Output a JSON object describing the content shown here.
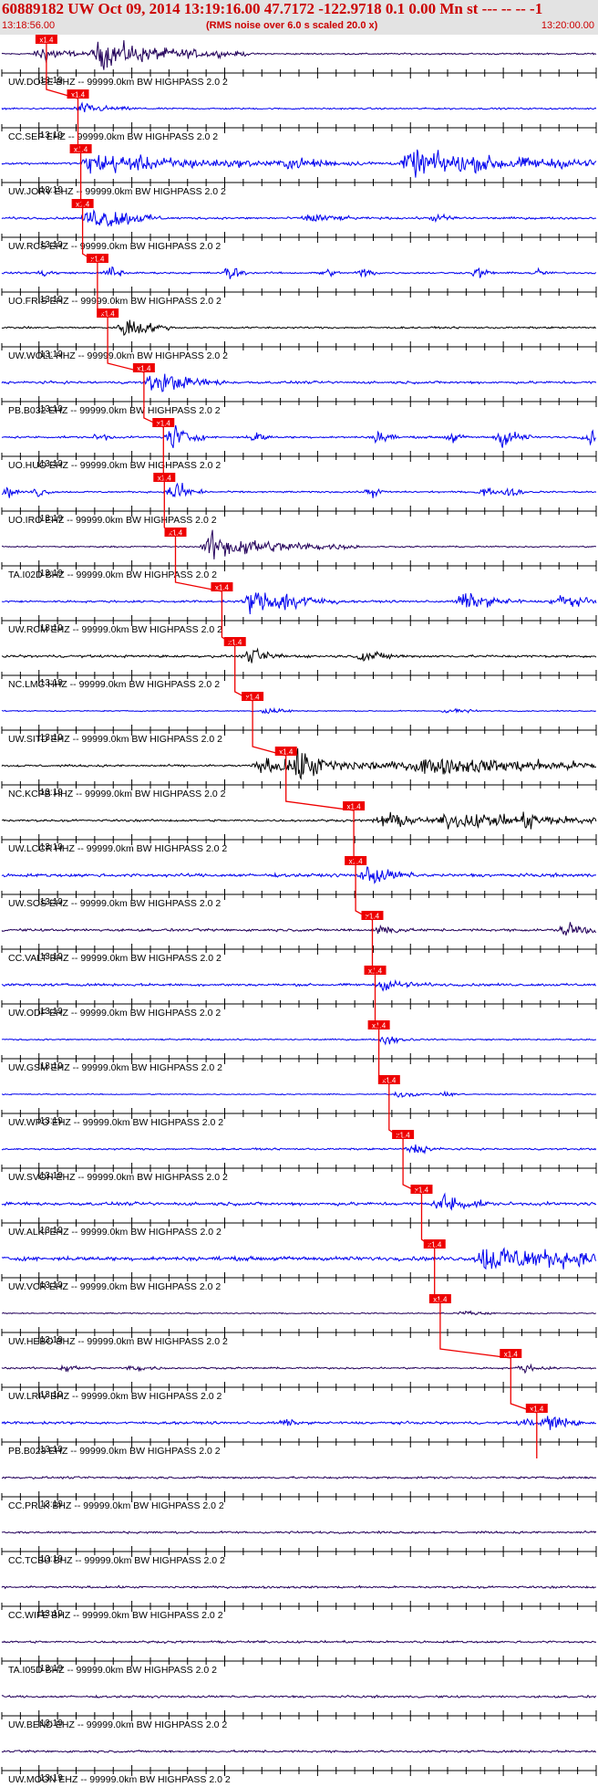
{
  "header": {
    "title": "60889182 UW Oct 09, 2014 13:19:16.00   47.7172 -122.9718  0.1 0.00 Mn st --- -- --   -1",
    "start_time": "13:18:56.00",
    "rms_note": "(RMS noise over 6.0 s scaled 20.0 x)",
    "end_time": "13:20:00.00"
  },
  "colors": {
    "blue_trace": "#0000ee",
    "black_trace": "#000000",
    "navy_trace": "#23005a",
    "pick": "#ee0000",
    "header_text": "#cc0000",
    "header_bg": "#e3e3e3"
  },
  "chart_data": {
    "type": "line",
    "x_unit": "seconds after 13:18:56.00",
    "x_range": [
      0,
      64
    ],
    "time_marker_label": "13:19",
    "time_marker_x": 4,
    "pick_label": "x1.4",
    "stations": [
      {
        "label": "UW.DOSE BHZ -- 99999.0km BW  HIGHPASS  2.0  2",
        "color": "navy",
        "pick": 4.8,
        "events": [
          [
            10.6,
            10,
            4.0
          ],
          [
            4.5,
            3,
            2.6
          ]
        ],
        "noise": 0.22
      },
      {
        "label": "CC.SEP EHZ -- 99999.0km BW  HIGHPASS  2.0  2",
        "color": "blue",
        "pick": 8.2,
        "events": [
          [
            8.6,
            4,
            1.4
          ]
        ],
        "noise": 0.22
      },
      {
        "label": "UW.JORV EHZ -- 99999.0km BW  HIGHPASS  2.0  2",
        "color": "blue",
        "pick": 8.5,
        "events": [
          [
            9.5,
            16,
            2.9
          ],
          [
            44,
            18,
            3.6
          ],
          [
            31,
            8,
            1.0
          ]
        ],
        "noise": 0.3
      },
      {
        "label": "UW.RCS EHZ -- 99999.0km BW  HIGHPASS  2.0  2",
        "color": "blue",
        "pick": 8.7,
        "events": [
          [
            9.6,
            5,
            2.6
          ],
          [
            33.4,
            3,
            1.5
          ],
          [
            46.9,
            2,
            1.0
          ],
          [
            11.8,
            3,
            1.6
          ]
        ],
        "noise": 0.3
      },
      {
        "label": "UO.FRIS EHZ -- 99999.0km BW  HIGHPASS  2.0  2",
        "color": "blue",
        "pick": 10.3,
        "events": [
          [
            24.8,
            1,
            2.7
          ],
          [
            12.0,
            1,
            2.4
          ],
          [
            39.1,
            1,
            1.6
          ],
          [
            51.5,
            1,
            1.8
          ],
          [
            4.6,
            1,
            1.2
          ],
          [
            57.8,
            1,
            1.1
          ],
          [
            35.0,
            1,
            1.1
          ]
        ],
        "noise": 0.25
      },
      {
        "label": "UW.WOLL HHZ -- 99999.0km BW  HIGHPASS  2.0  2",
        "color": "black",
        "pick": 11.4,
        "events": [
          [
            13.5,
            3,
            3.4
          ]
        ],
        "noise": 0.25
      },
      {
        "label": "PB.B032 EHZ -- 99999.0km BW  HIGHPASS  2.0  2",
        "color": "blue",
        "pick": 15.3,
        "events": [
          [
            16.5,
            5,
            3.2
          ]
        ],
        "noise": 0.35
      },
      {
        "label": "UO.HUO EHZ -- 99999.0km BW  HIGHPASS  2.0  2",
        "color": "blue",
        "pick": 17.4,
        "events": [
          [
            18.6,
            2,
            4.0
          ],
          [
            41.0,
            1,
            3.0
          ],
          [
            54.0,
            2,
            3.0
          ],
          [
            63.4,
            1,
            2.2
          ],
          [
            27.5,
            1,
            1.7
          ],
          [
            48.6,
            1,
            1.5
          ],
          [
            10.8,
            1,
            1.3
          ]
        ],
        "noise": 0.28
      },
      {
        "label": "UO.IRO EHZ -- 99999.0km BW  HIGHPASS  2.0  2",
        "color": "blue",
        "pick": 17.5,
        "events": [
          [
            18.8,
            2,
            3.2
          ],
          [
            55.0,
            1,
            2.4
          ],
          [
            52.0,
            1,
            1.6
          ],
          [
            0.8,
            1,
            1.5
          ],
          [
            40.0,
            1,
            1.4
          ],
          [
            4.0,
            1,
            1.5
          ]
        ],
        "noise": 0.24
      },
      {
        "label": "TA.I02D BHZ -- 99999.0km BW  HIGHPASS  2.0  2",
        "color": "navy",
        "pick": 18.7,
        "events": [
          [
            22.5,
            10,
            3.8
          ]
        ],
        "noise": 0.2
      },
      {
        "label": "UW.RCM EHZ -- 99999.0km BW  HIGHPASS  2.0  2",
        "color": "blue",
        "pick": 23.7,
        "events": [
          [
            27.0,
            6,
            3.6
          ],
          [
            49.8,
            4,
            2.6
          ],
          [
            60.0,
            3,
            2.2
          ],
          [
            31.0,
            2,
            1.8
          ]
        ],
        "noise": 0.3
      },
      {
        "label": "NC.LMC HHZ -- 99999.0km BW  HIGHPASS  2.0  2",
        "color": "black",
        "pick": 25.1,
        "events": [
          [
            27.0,
            3,
            1.8
          ],
          [
            39.0,
            3,
            1.6
          ]
        ],
        "noise": 0.35
      },
      {
        "label": "UW.SITD EHZ -- 99999.0km BW  HIGHPASS  2.0  2",
        "color": "blue",
        "pick": 27.0,
        "events": [
          [
            28.8,
            2,
            1.3
          ],
          [
            48.4,
            2,
            1.0
          ]
        ],
        "noise": 0.15
      },
      {
        "label": "NC.KCPB HHZ -- 99999.0km BW  HIGHPASS  2.0  2",
        "color": "black",
        "pick": 30.6,
        "events": [
          [
            31.8,
            3,
            3.8
          ],
          [
            28.0,
            25,
            1.9
          ],
          [
            45.0,
            28,
            1.6
          ]
        ],
        "noise": 0.3
      },
      {
        "label": "UW.LCCR HHZ -- 99999.0km BW  HIGHPASS  2.0  2",
        "color": "black",
        "pick": 37.9,
        "events": [
          [
            41.0,
            4,
            2.6
          ],
          [
            48.0,
            22,
            2.0
          ],
          [
            57.0,
            1,
            1.8
          ]
        ],
        "noise": 0.3
      },
      {
        "label": "UW.SOS EHZ -- 99999.0km BW  HIGHPASS  2.0  2",
        "color": "blue",
        "pick": 38.1,
        "events": [
          [
            39.6,
            3,
            2.8
          ]
        ],
        "noise": 0.45
      },
      {
        "label": "CC.VALT BHZ -- 99999.0km BW  HIGHPASS  2.0  2",
        "color": "navy",
        "pick": 39.9,
        "events": [
          [
            41.0,
            2,
            1.6
          ],
          [
            61.0,
            3,
            2.4
          ]
        ],
        "noise": 0.35
      },
      {
        "label": "UW.ODF EHZ -- 99999.0km BW  HIGHPASS  2.0  2",
        "color": "blue",
        "pick": 40.2,
        "events": [
          [
            41.4,
            3,
            1.5
          ]
        ],
        "noise": 0.35
      },
      {
        "label": "UW.GSM EHZ -- 99999.0km BW  HIGHPASS  2.0  2",
        "color": "blue",
        "pick": 40.6,
        "events": [
          [
            41.6,
            2,
            1.4
          ]
        ],
        "noise": 0.2
      },
      {
        "label": "UW.WPO EHZ -- 99999.0km BW  HIGHPASS  2.0  2",
        "color": "blue",
        "pick": 41.7,
        "events": [
          [
            43.0,
            2,
            1.1
          ],
          [
            48.2,
            1,
            0.7
          ]
        ],
        "noise": 0.15
      },
      {
        "label": "UW.SVOH EHZ -- 99999.0km BW  HIGHPASS  2.0  2",
        "color": "blue",
        "pick": 43.2,
        "events": [
          [
            44.4,
            2,
            1.6
          ]
        ],
        "noise": 0.25
      },
      {
        "label": "UW.ALKI EHZ -- 99999.0km BW  HIGHPASS  2.0  2",
        "color": "blue",
        "pick": 45.2,
        "events": [
          [
            47.6,
            3,
            3.0
          ]
        ],
        "noise": 0.45
      },
      {
        "label": "UW.VCR EHZ -- 99999.0km BW  HIGHPASS  2.0  2",
        "color": "blue",
        "pick": 46.6,
        "events": [
          [
            52.0,
            14,
            4.0
          ]
        ],
        "noise": 0.55
      },
      {
        "label": "UW.HEBO BHZ -- 99999.0km BW  HIGHPASS  2.0  2",
        "color": "navy",
        "pick": 47.2,
        "events": [
          [
            50.0,
            2,
            1.0
          ]
        ],
        "noise": 0.18
      },
      {
        "label": "UW.LRIV BHZ -- 99999.0km BW  HIGHPASS  2.0  2",
        "color": "navy",
        "pick": 54.8,
        "events": [
          [
            6.8,
            2,
            1.0
          ],
          [
            14.3,
            2,
            0.9
          ],
          [
            56.3,
            2,
            1.0
          ]
        ],
        "noise": 0.25
      },
      {
        "label": "PB.B023 EHZ -- 99999.0km BW  HIGHPASS  2.0  2",
        "color": "blue",
        "pick": 57.6,
        "events": [
          [
            59.2,
            2,
            3.4
          ],
          [
            30.8,
            1,
            1.0
          ],
          [
            56.5,
            1,
            1.2
          ]
        ],
        "noise": 0.35
      },
      {
        "label": "CC.PRLK BHZ -- 99999.0km BW  HIGHPASS  2.0  2",
        "color": "navy",
        "pick": null,
        "events": [],
        "noise": 0.3
      },
      {
        "label": "CC.TCBU BHZ -- 99999.0km BW  HIGHPASS  2.0  2",
        "color": "navy",
        "pick": null,
        "events": [],
        "noise": 0.3
      },
      {
        "label": "CC.WIFE BHZ -- 99999.0km BW  HIGHPASS  2.0  2",
        "color": "navy",
        "pick": null,
        "events": [],
        "noise": 0.3
      },
      {
        "label": "TA.I05D BHZ -- 99999.0km BW  HIGHPASS  2.0  2",
        "color": "navy",
        "pick": null,
        "events": [],
        "noise": 0.3
      },
      {
        "label": "UW.BEND EHZ -- 99999.0km BW  HIGHPASS  2.0  2",
        "color": "navy",
        "pick": null,
        "events": [],
        "noise": 0.3
      },
      {
        "label": "UW.MOON EHZ -- 99999.0km BW  HIGHPASS  2.0  2",
        "color": "navy",
        "pick": null,
        "events": [],
        "noise": 0.3
      }
    ]
  }
}
